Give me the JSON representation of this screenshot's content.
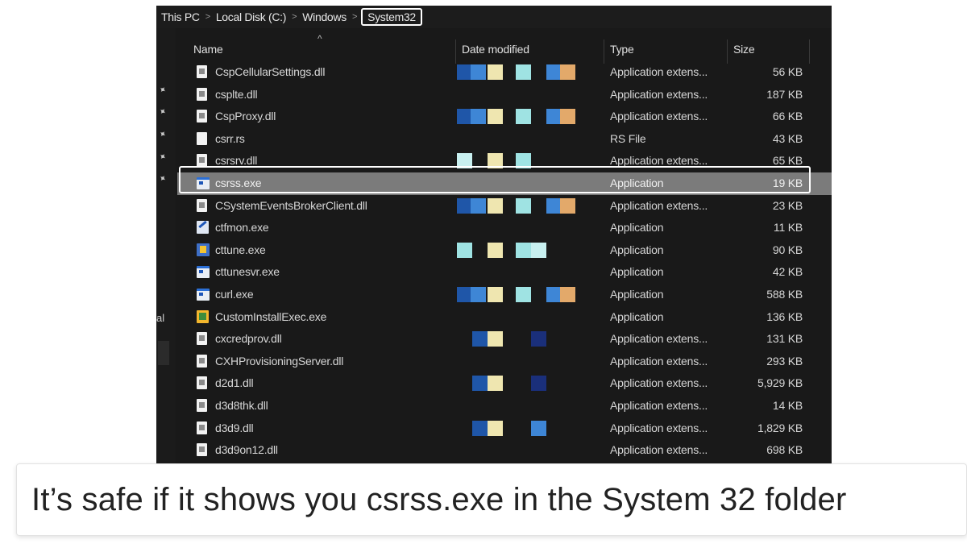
{
  "breadcrumb": [
    "This PC",
    "Local Disk (C:)",
    "Windows",
    "System32"
  ],
  "columns": {
    "name": "Name",
    "date": "Date modified",
    "type": "Type",
    "size": "Size"
  },
  "left_pane": {
    "label_fragment": "al"
  },
  "files": [
    {
      "name": "CspCellularSettings.dll",
      "type": "Application extens...",
      "size": "56 KB",
      "icon": "dll-file-icon"
    },
    {
      "name": "csplte.dll",
      "type": "Application extens...",
      "size": "187 KB",
      "icon": "dll-file-icon"
    },
    {
      "name": "CspProxy.dll",
      "type": "Application extens...",
      "size": "66 KB",
      "icon": "dll-file-icon"
    },
    {
      "name": "csrr.rs",
      "type": "RS File",
      "size": "43 KB",
      "icon": "generic-file-icon"
    },
    {
      "name": "csrsrv.dll",
      "type": "Application extens...",
      "size": "65 KB",
      "icon": "dll-file-icon"
    },
    {
      "name": "csrss.exe",
      "type": "Application",
      "size": "19 KB",
      "icon": "exe-app-icon",
      "selected": true
    },
    {
      "name": "CSystemEventsBrokerClient.dll",
      "type": "Application extens...",
      "size": "23 KB",
      "icon": "dll-file-icon"
    },
    {
      "name": "ctfmon.exe",
      "type": "Application",
      "size": "11 KB",
      "icon": "ctfmon-app-icon"
    },
    {
      "name": "cttune.exe",
      "type": "Application",
      "size": "90 KB",
      "icon": "cttune-app-icon"
    },
    {
      "name": "cttunesvr.exe",
      "type": "Application",
      "size": "42 KB",
      "icon": "exe-app-icon"
    },
    {
      "name": "curl.exe",
      "type": "Application",
      "size": "588 KB",
      "icon": "exe-app-icon"
    },
    {
      "name": "CustomInstallExec.exe",
      "type": "Application",
      "size": "136 KB",
      "icon": "installer-app-icon"
    },
    {
      "name": "cxcredprov.dll",
      "type": "Application extens...",
      "size": "131 KB",
      "icon": "dll-file-icon"
    },
    {
      "name": "CXHProvisioningServer.dll",
      "type": "Application extens...",
      "size": "293 KB",
      "icon": "dll-file-icon"
    },
    {
      "name": "d2d1.dll",
      "type": "Application extens...",
      "size": "5,929 KB",
      "icon": "dll-file-icon"
    },
    {
      "name": "d3d8thk.dll",
      "type": "Application extens...",
      "size": "14 KB",
      "icon": "dll-file-icon"
    },
    {
      "name": "d3d9.dll",
      "type": "Application extens...",
      "size": "1,829 KB",
      "icon": "dll-file-icon"
    },
    {
      "name": "d3d9on12.dll",
      "type": "Application extens...",
      "size": "698 KB",
      "icon": "dll-file-icon"
    }
  ],
  "redaction_colors": {
    "dark_blue": "#1f56a8",
    "blue": "#3e86d6",
    "cream": "#efe6b0",
    "cyan": "#9fe3e3",
    "light_cyan": "#c8f0f0",
    "orange": "#e3a96a",
    "navy": "#1a2f7a"
  },
  "caption": "It’s safe if it shows you csrss.exe in the System 32 folder"
}
